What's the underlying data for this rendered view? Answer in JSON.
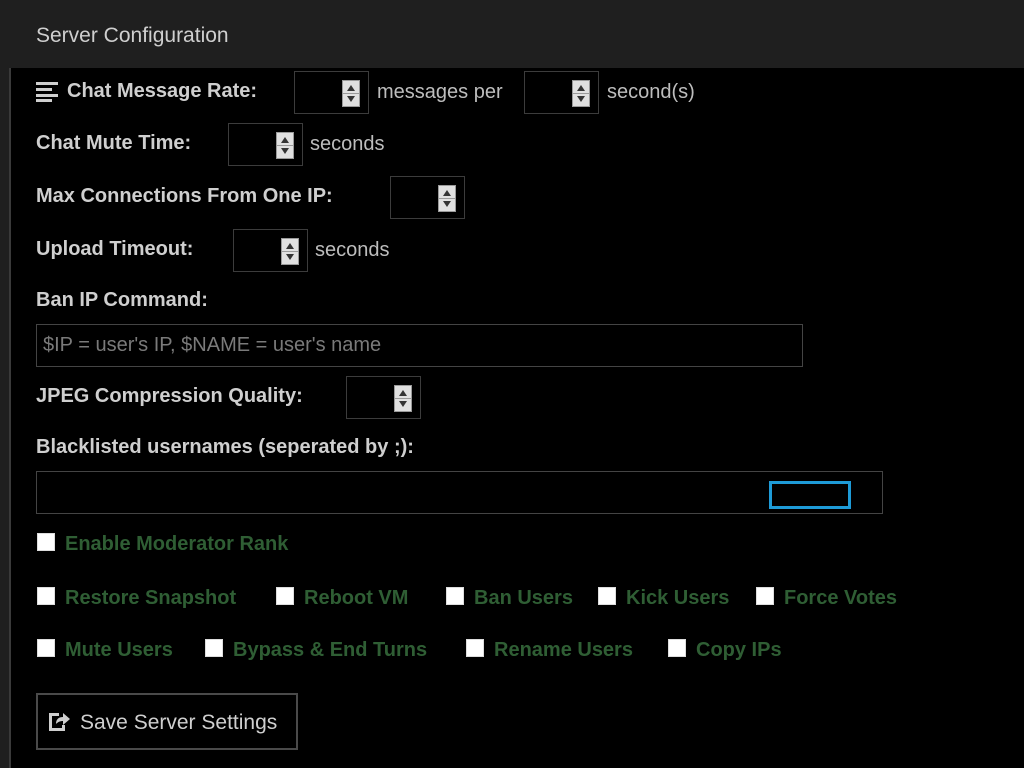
{
  "header": {
    "title": "Server Configuration"
  },
  "chat_rate": {
    "label": "Chat Message Rate:",
    "messages_per": "messages per",
    "seconds_unit": "second(s)"
  },
  "chat_mute": {
    "label": "Chat Mute Time:",
    "unit": "seconds"
  },
  "max_conn": {
    "label": "Max Connections From One IP:"
  },
  "upload_timeout": {
    "label": "Upload Timeout:",
    "unit": "seconds"
  },
  "ban_ip": {
    "label": "Ban IP Command:",
    "placeholder": "$IP = user's IP, $NAME = user's name"
  },
  "jpeg": {
    "label": "JPEG Compression Quality:"
  },
  "blacklist": {
    "label": "Blacklisted usernames (seperated by ;):"
  },
  "moderator": {
    "enable_label": "Enable Moderator Rank"
  },
  "permissions": {
    "row1": [
      "Restore Snapshot",
      "Reboot VM",
      "Ban Users",
      "Kick Users",
      "Force Votes"
    ],
    "row2": [
      "Mute Users",
      "Bypass & End Turns",
      "Rename Users",
      "Copy IPs"
    ]
  },
  "save_button": {
    "label": "Save Server Settings"
  },
  "colors": {
    "accent_focus": "#1e9bd7",
    "permission_text": "#2f5e34"
  }
}
